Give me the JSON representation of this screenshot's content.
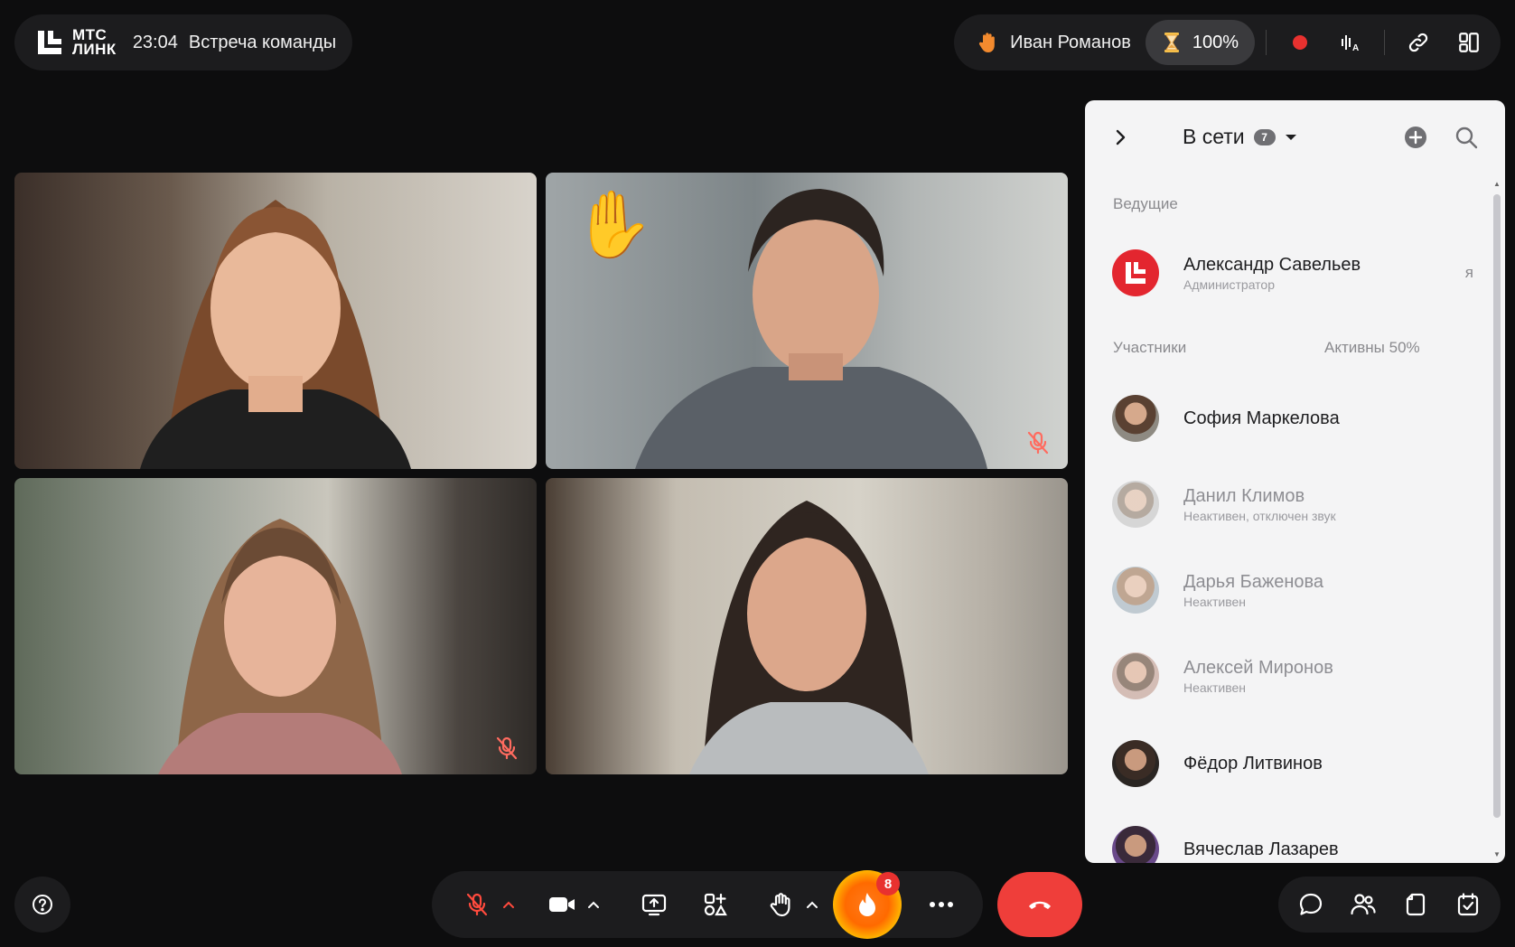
{
  "header": {
    "logo_line1": "МТС",
    "logo_line2": "ЛИНК",
    "time": "23:04",
    "meeting_title": "Встреча команды",
    "presenter_name": "Иван Романов",
    "timer_value": "100%"
  },
  "panel": {
    "title": "В сети",
    "online_count": "7",
    "hosts_label": "Ведущие",
    "host": {
      "name": "Александр Савельев",
      "role": "Администратор",
      "me_marker": "я"
    },
    "participants_label": "Участники",
    "active_label": "Активны 50%",
    "participants": [
      {
        "name": "София Маркелова",
        "status": ""
      },
      {
        "name": "Данил Климов",
        "status": "Неактивен, отключен звук"
      },
      {
        "name": "Дарья Баженова",
        "status": "Неактивен"
      },
      {
        "name": "Алексей Миронов",
        "status": "Неактивен"
      },
      {
        "name": "Фёдор Литвинов",
        "status": ""
      },
      {
        "name": "Вячеслав Лазарев",
        "status": ""
      }
    ]
  },
  "controls": {
    "reactions_count": "8"
  },
  "colors": {
    "accent_red": "#ef3e3a",
    "panel_bg": "#f4f4f5",
    "bar_bg": "#1c1c1e",
    "page_bg": "#0d0d0e"
  },
  "icons": {
    "top_bar": [
      "hand-raised-icon",
      "hourglass-icon",
      "record-icon",
      "transcript-icon",
      "link-icon",
      "layout-icon"
    ],
    "bottom_bar": [
      "help-icon",
      "mic-off-icon",
      "camera-icon",
      "share-screen-icon",
      "apps-icon",
      "raise-hand-icon",
      "reactions-fire-icon",
      "more-icon",
      "hang-up-icon",
      "chat-icon",
      "participants-icon",
      "files-icon",
      "tasks-icon"
    ]
  }
}
